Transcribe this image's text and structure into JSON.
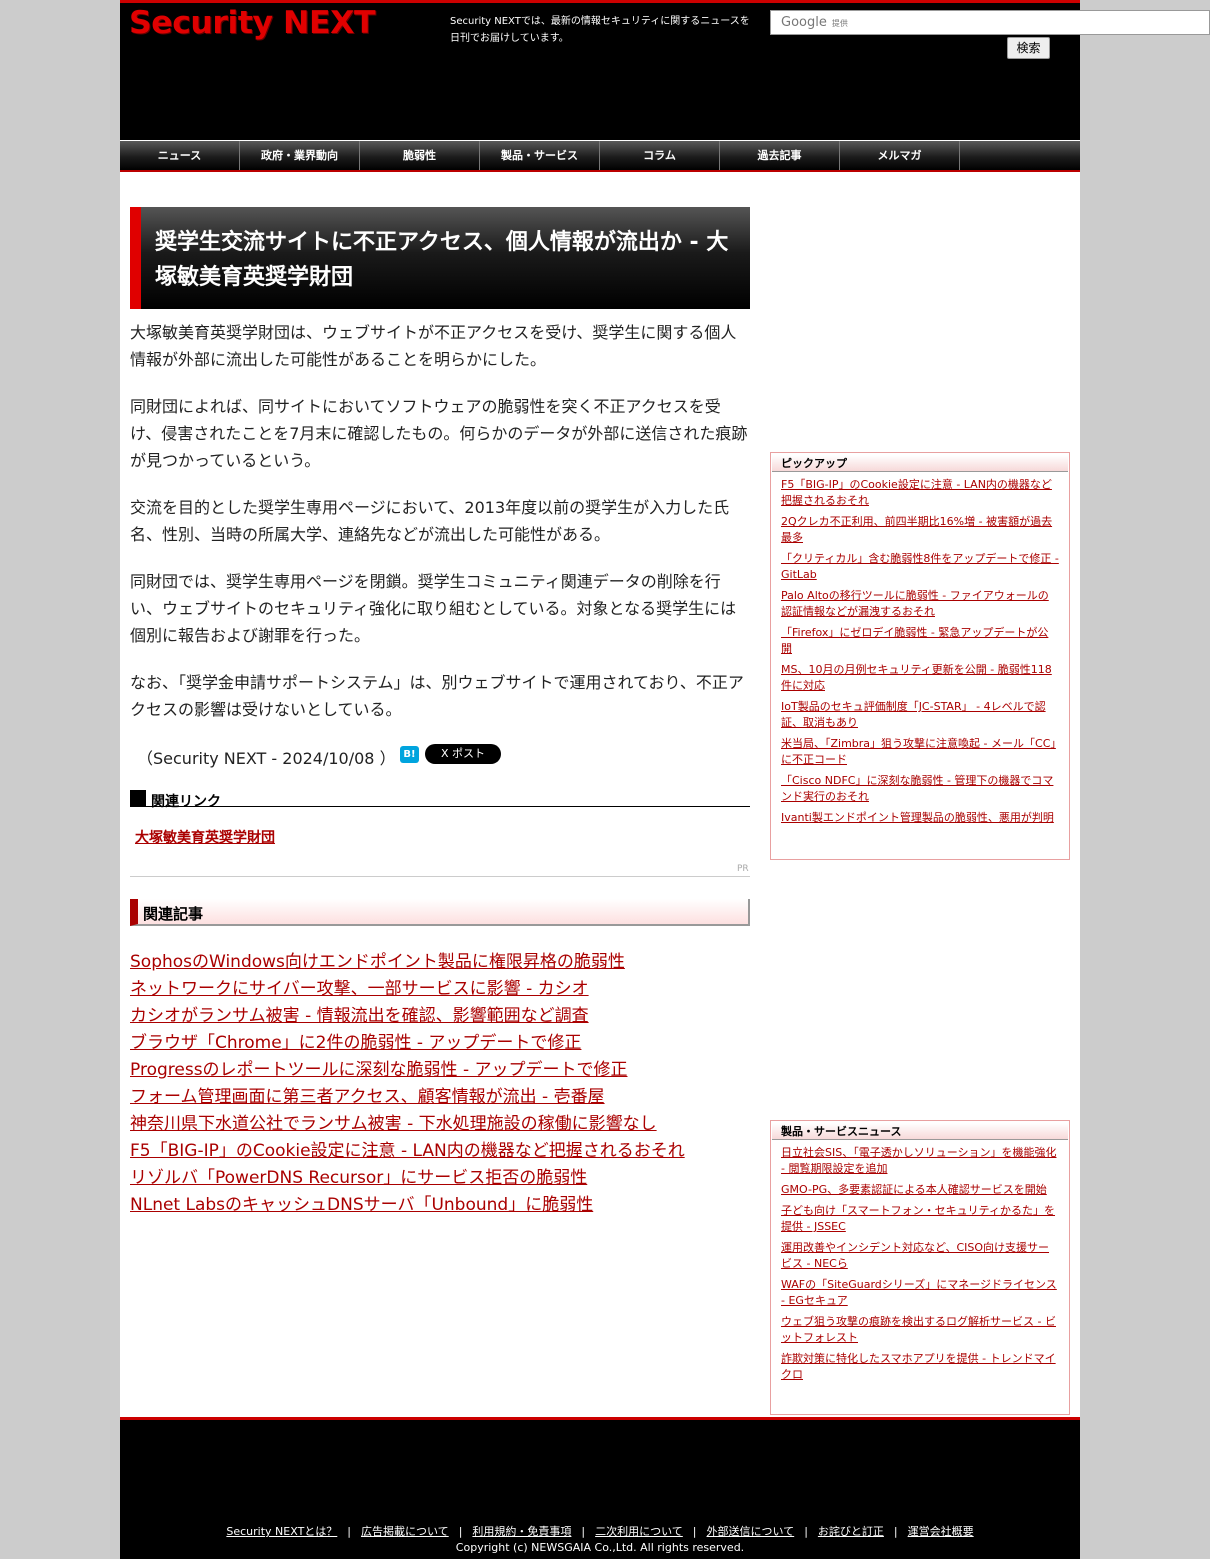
{
  "header": {
    "logo_text": "Security NEXT",
    "tagline": "Security NEXTでは、最新の情報セキュリティに関するニュースを日刊でお届けしています。",
    "search": {
      "brand": "Google",
      "brand_suffix": "提供",
      "button_label": "検索"
    }
  },
  "nav": {
    "items": [
      {
        "label": "ニュース"
      },
      {
        "label": "政府・業界動向"
      },
      {
        "label": "脆弱性"
      },
      {
        "label": "製品・サービス"
      },
      {
        "label": "コラム"
      },
      {
        "label": "過去記事"
      },
      {
        "label": "メルマガ"
      }
    ]
  },
  "article": {
    "title": "奨学生交流サイトに不正アクセス、個人情報が流出か - 大塚敏美育英奨学財団",
    "paragraphs": [
      "大塚敏美育英奨学財団は、ウェブサイトが不正アクセスを受け、奨学生に関する個人情報が外部に流出した可能性があることを明らかにした。",
      "同財団によれば、同サイトにおいてソフトウェアの脆弱性を突く不正アクセスを受け、侵害されたことを7月末に確認したもの。何らかのデータが外部に送信された痕跡が見つかっているという。",
      "交流を目的とした奨学生専用ページにおいて、2013年度以前の奨学生が入力した氏名、性別、当時の所属大学、連絡先などが流出した可能性がある。",
      "同財団では、奨学生専用ページを閉鎖。奨学生コミュニティ関連データの削除を行い、ウェブサイトのセキュリティ強化に取り組むとしている。対象となる奨学生には個別に報告および謝罪を行った。",
      "なお、「奨学金申請サポートシステム」は、別ウェブサイトで運用されており、不正アクセスの影響は受けないとしている。"
    ],
    "byline": "（Security NEXT - 2024/10/08 ）",
    "share": {
      "hatena": "B!",
      "tweet": "X ポスト"
    },
    "links_heading": "関連リンク",
    "org_link": "大塚敏美育英奨学財団",
    "pr_label": "PR",
    "related_heading": "関連記事",
    "related": [
      "SophosのWindows向けエンドポイント製品に権限昇格の脆弱性",
      "ネットワークにサイバー攻撃、一部サービスに影響 - カシオ",
      "カシオがランサム被害 - 情報流出を確認、影響範囲など調査",
      "ブラウザ「Chrome」に2件の脆弱性 - アップデートで修正",
      "Progressのレポートツールに深刻な脆弱性 - アップデートで修正",
      "フォーム管理画面に第三者アクセス、顧客情報が流出 - 壱番屋",
      "神奈川県下水道公社でランサム被害 - 下水処理施設の稼働に影響なし",
      "F5「BIG-IP」のCookie設定に注意 - LAN内の機器など把握されるおそれ",
      "リゾルバ「PowerDNS Recursor」にサービス拒否の脆弱性",
      "NLnet LabsのキャッシュDNSサーバ「Unbound」に脆弱性"
    ]
  },
  "sidebar": {
    "pickup": {
      "heading": "ピックアップ",
      "items": [
        "F5「BIG-IP」のCookie設定に注意 - LAN内の機器など把握されるおそれ",
        "2Qクレカ不正利用、前四半期比16%増 - 被害額が過去最多",
        "「クリティカル」含む脆弱性8件をアップデートで修正 - GitLab",
        "Palo Altoの移行ツールに脆弱性 - ファイアウォールの認証情報などが漏洩するおそれ",
        "「Firefox」にゼロデイ脆弱性 - 緊急アップデートが公開",
        "MS、10月の月例セキュリティ更新を公開 - 脆弱性118件に対応",
        "IoT製品のセキュ評価制度「JC-STAR」 - 4レベルで認証、取消もあり",
        "米当局、「Zimbra」狙う攻撃に注意喚起 - メール「CC」に不正コード",
        "「Cisco NDFC」に深刻な脆弱性 - 管理下の機器でコマンド実行のおそれ",
        "Ivanti製エンドポイント管理製品の脆弱性、悪用が判明"
      ]
    },
    "products": {
      "heading": "製品・サービスニュース",
      "items": [
        "日立社会SIS、「電子透かしソリューション」を機能強化 - 閲覧期限設定を追加",
        "GMO-PG、多要素認証による本人確認サービスを開始",
        "子ども向け「スマートフォン・セキュリティかるた」を提供 - JSSEC",
        "運用改善やインシデント対応など、CISO向け支援サービス - NECら",
        "WAFの「SiteGuardシリーズ」にマネージドライセンス - EGセキュア",
        "ウェブ狙う攻撃の痕跡を検出するログ解析サービス - ビットフォレスト",
        "詐欺対策に特化したスマホアプリを提供 - トレンドマイクロ"
      ]
    }
  },
  "footer": {
    "links": [
      "Security NEXTとは？",
      "広告掲載について",
      "利用規約・免責事項",
      "二次利用について",
      "外部送信について",
      "お詫びと訂正",
      "運営会社概要"
    ],
    "copyright": "Copyright (c) NEWSGAIA Co.,Ltd. All rights reserved."
  },
  "colors": {
    "brand_red": "#e00000",
    "link_red": "#aa0000",
    "header_bg": "#000000"
  }
}
